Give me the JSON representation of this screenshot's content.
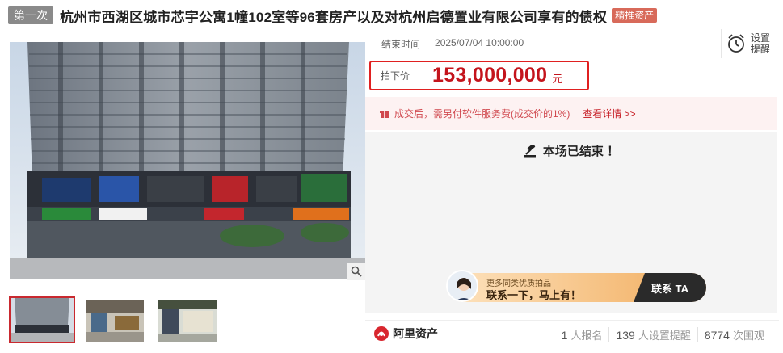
{
  "title": {
    "round_tag": "第一次",
    "text": "杭州市西湖区城市芯宇公寓1幢102室等96套房产以及对杭州启德置业有限公司享有的债权",
    "quality_tag": "精推资产"
  },
  "auction": {
    "end_label": "结束时间",
    "end_time": "2025/07/04 10:00:00",
    "remind_label": "设置提醒",
    "price_label": "拍下价",
    "price_value": "153,000,000",
    "price_unit": "元",
    "notice_text": "成交后，需另付软件服务费(成交价的1%)",
    "notice_link": "查看详情 >>",
    "ended_text": "本场已结束 ！"
  },
  "banner": {
    "sub": "更多同类优质拍品",
    "main": "联系一下，马上有！",
    "button": "联系 TA"
  },
  "footer": {
    "brand": "阿里资产",
    "stats": [
      {
        "num": "1",
        "label": "人报名"
      },
      {
        "num": "139",
        "label": "人设置提醒"
      },
      {
        "num": "8774",
        "label": "次围观"
      }
    ]
  },
  "icons": {
    "zoom": "magnifier-icon",
    "remind": "alarm-clock-icon",
    "notice": "gift-icon",
    "ended": "gavel-icon",
    "brand": "ali-asset-logo-icon"
  },
  "colors": {
    "accent_red": "#c4141c",
    "price_border": "#e02020",
    "quality_tag": "#d86a5a",
    "round_tag": "#8a8a8a"
  }
}
